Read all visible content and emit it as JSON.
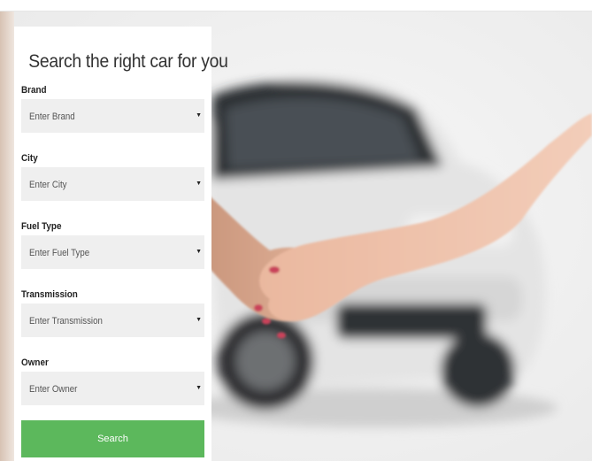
{
  "search_form": {
    "title": "Search the right car for you",
    "fields": [
      {
        "label": "Brand",
        "placeholder": "Enter Brand"
      },
      {
        "label": "City",
        "placeholder": "Enter City"
      },
      {
        "label": "Fuel Type",
        "placeholder": "Enter Fuel Type"
      },
      {
        "label": "Transmission",
        "placeholder": "Enter Transmission"
      },
      {
        "label": "Owner",
        "placeholder": "Enter Owner"
      }
    ],
    "submit_label": "Search"
  },
  "theme": {
    "accent": "#5cb85c",
    "field_background": "#efefef",
    "panel_background": "#ffffff"
  },
  "icons": {
    "dropdown": "caret-down-icon"
  }
}
